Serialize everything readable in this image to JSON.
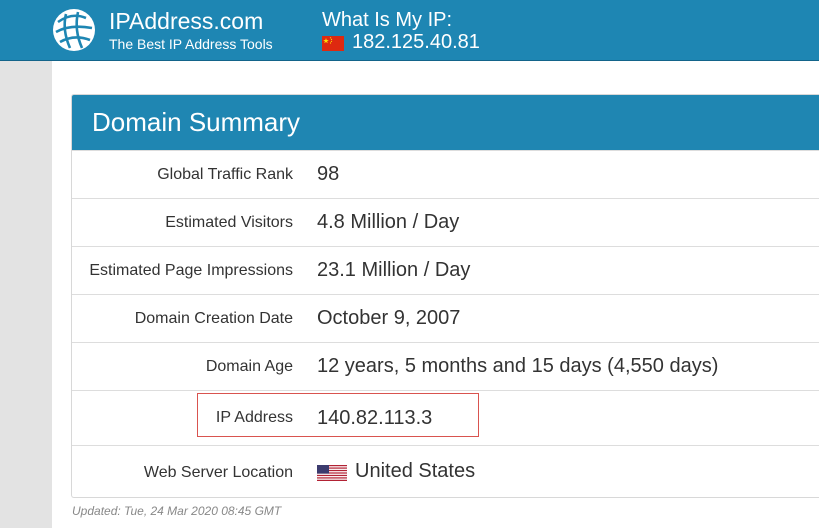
{
  "header": {
    "brand_title": "IPAddress.com",
    "brand_tagline": "The Best IP Address Tools",
    "my_ip_label": "What Is My IP:",
    "my_ip_value": "182.125.40.81",
    "my_ip_flag": "china-flag-icon",
    "bg_color": "#1e86b3"
  },
  "panel": {
    "title": "Domain Summary",
    "header_color": "#1f86b2",
    "rows": [
      {
        "label": "Global Traffic Rank",
        "value": "98"
      },
      {
        "label": "Estimated Visitors",
        "value": "4.8 Million / Day"
      },
      {
        "label": "Estimated Page Impressions",
        "value": "23.1 Million / Day"
      },
      {
        "label": "Domain Creation Date",
        "value": "October 9, 2007"
      },
      {
        "label": "Domain Age",
        "value": "12 years, 5 months and 15 days (4,550 days)"
      },
      {
        "label": "IP Address",
        "value": "140.82.113.3",
        "highlighted": true,
        "highlight_color": "#d9534f"
      },
      {
        "label": "Web Server Location",
        "value": "United States",
        "flag": "us-flag-icon"
      }
    ]
  },
  "footer": {
    "updated": "Updated: Tue, 24 Mar 2020 08:45 GMT"
  }
}
